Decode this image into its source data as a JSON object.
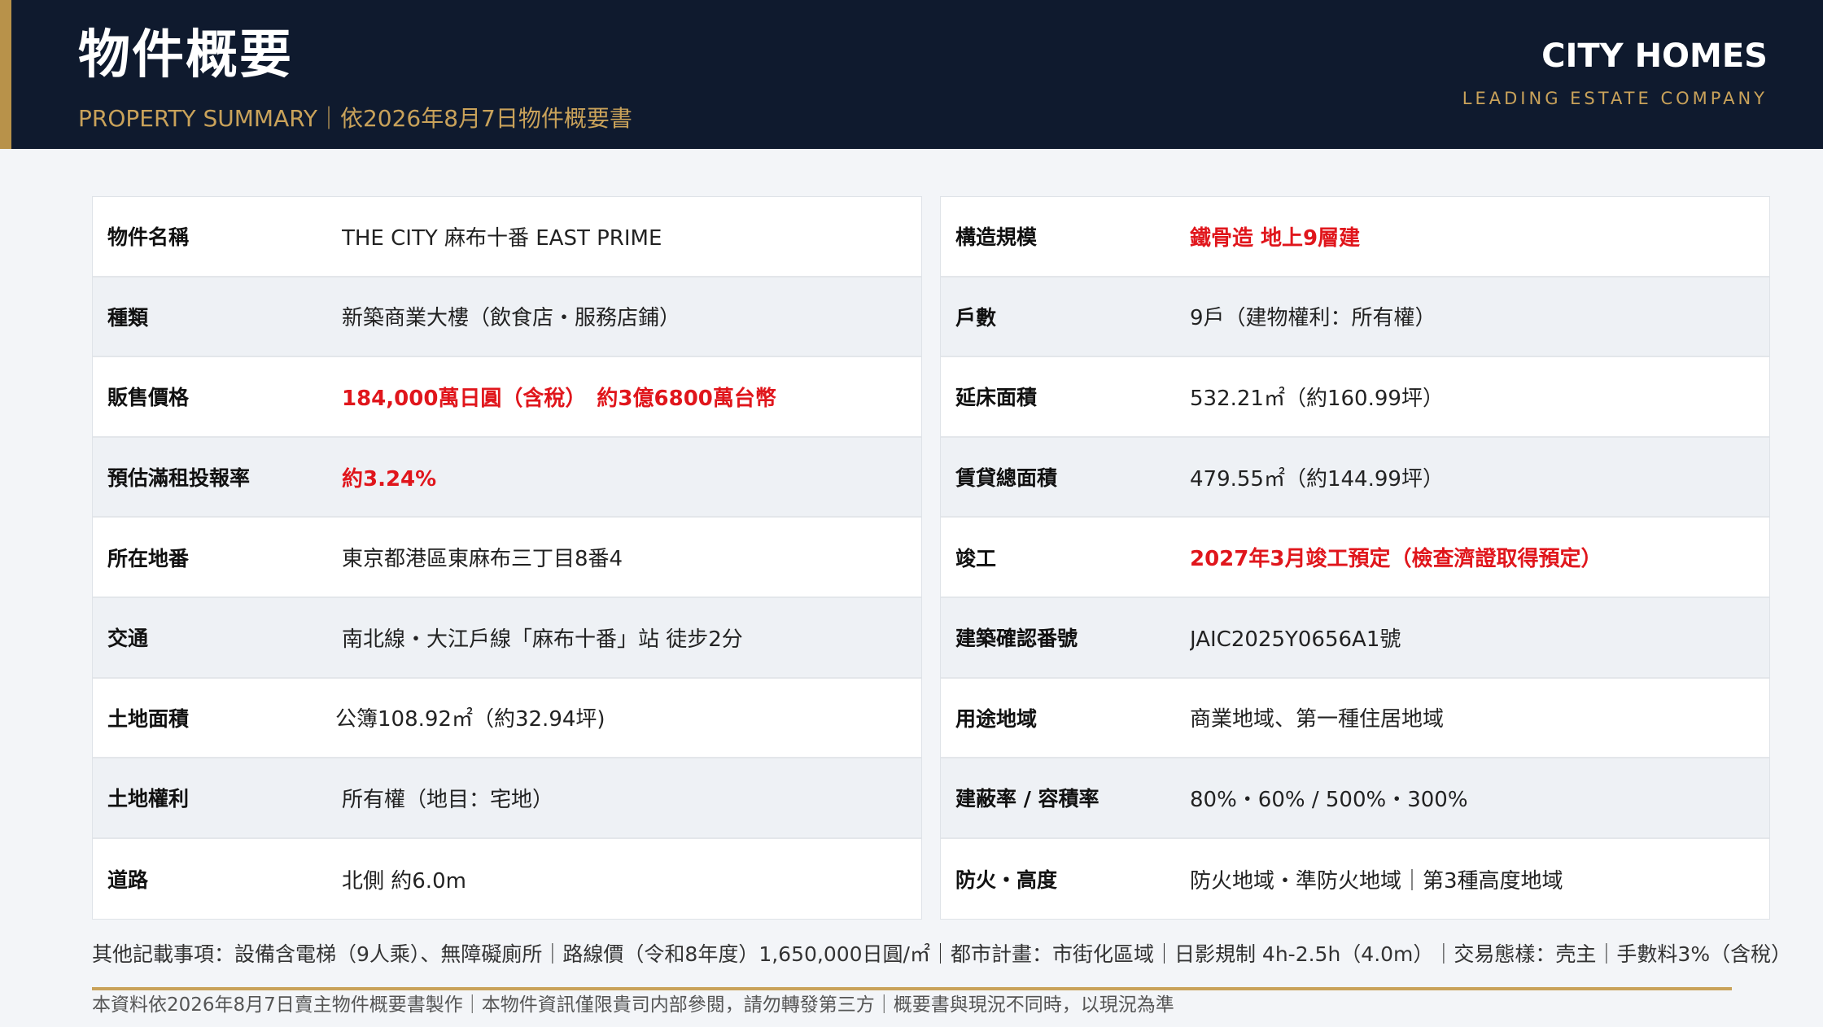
{
  "header": {
    "title": "物件概要",
    "subtitle": "PROPERTY SUMMARY｜依2026年8月7日物件概要書",
    "brand": "CITY HOMES",
    "tagline": "LEADING ESTATE COMPANY"
  },
  "colors": {
    "header_bg": "#0f1a2e",
    "gold": "#c9a25a",
    "highlight_red": "#e0161c"
  },
  "left_table": [
    {
      "label": "物件名稱",
      "value": "THE CITY 麻布十番 EAST PRIME"
    },
    {
      "label": "種類",
      "value": "新築商業大樓（飲食店・服務店鋪）"
    },
    {
      "label": "販售價格",
      "value": "184,000萬日圓（含稅）　約3億6800萬台幣"
    },
    {
      "label": "預估滿租投報率",
      "value": "約3.24%"
    },
    {
      "label": "所在地番",
      "value": "東京都港區東麻布三丁目8番4"
    },
    {
      "label": "交通",
      "value": "南北線・大江戶線「麻布十番」站 徒步2分"
    },
    {
      "label": "土地面積",
      "value": "公簿108.92㎡（約32.94坪)"
    },
    {
      "label": "土地權利",
      "value": "所有權（地目：宅地）"
    },
    {
      "label": "道路",
      "value": "北側 約6.0m"
    }
  ],
  "right_table": [
    {
      "label": "構造規模",
      "value": "鐵骨造 地上9層建"
    },
    {
      "label": "戶數",
      "value": "9戶（建物權利：所有權）"
    },
    {
      "label": "延床面積",
      "value": "532.21㎡（約160.99坪）"
    },
    {
      "label": "賃貸總面積",
      "value": "479.55㎡（約144.99坪）"
    },
    {
      "label": "竣工",
      "value": "2027年3月竣工預定（檢查濟證取得預定）"
    },
    {
      "label": "建築確認番號",
      "value": "JAIC2025Y0656A1號"
    },
    {
      "label": "用途地域",
      "value": "商業地域、第一種住居地域"
    },
    {
      "label": "建蔽率 / 容積率",
      "value": "80%・60% / 500%・300%"
    },
    {
      "label": "防火・高度",
      "value": "防火地域・準防火地域｜第3種高度地域"
    }
  ],
  "notes": "其他記載事項：設備含電梯（9人乘）、無障礙廁所｜路線價（令和8年度）1,650,000日圓/㎡｜都市計畫：市街化區域｜日影規制 4h-2.5h（4.0m）｜交易態樣：壳主｜手數料3%（含稅）",
  "footer": "本資料依2026年8月7日賣主物件概要書製作｜本物件資訊僅限貴司内部參閱，請勿轉發第三方｜概要書與現況不同時，以現況為準"
}
